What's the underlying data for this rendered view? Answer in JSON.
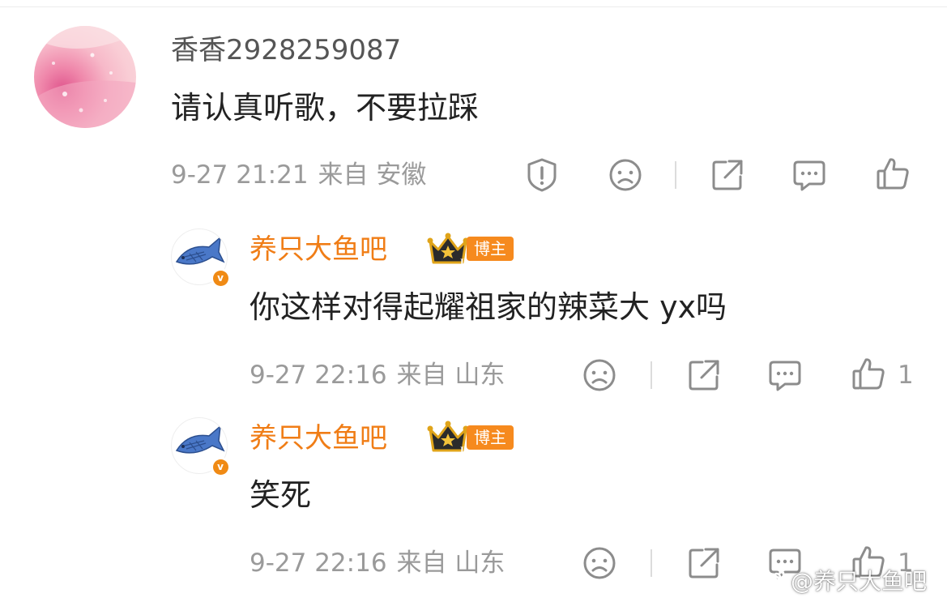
{
  "comments": [
    {
      "username": "香香2928259087",
      "text": "请认真听歌，不要拉踩",
      "time": "9-27 21:21",
      "location": "来自 安徽",
      "actions": [
        "report-icon",
        "sad-face-icon",
        "share-icon",
        "comment-icon",
        "like-icon"
      ]
    }
  ],
  "replies": [
    {
      "username": "养只大鱼吧",
      "badge_label": "博主",
      "crown_level": "II",
      "verified_mark": "v",
      "text": "你这样对得起耀祖家的辣菜大 yx吗",
      "time": "9-27 22:16",
      "location": "来自 山东",
      "like_count": "1"
    },
    {
      "username": "养只大鱼吧",
      "badge_label": "博主",
      "crown_level": "II",
      "verified_mark": "v",
      "text": "笑死",
      "time": "9-27 22:16",
      "location": "来自 山东",
      "like_count": "1"
    }
  ],
  "watermark": {
    "text": "@养只大鱼吧"
  },
  "colors": {
    "username_orange": "#f07d16",
    "blogger_badge": "#f68a1e",
    "meta_grey": "#9a9a9a",
    "icon_grey": "#8c8c8c"
  }
}
